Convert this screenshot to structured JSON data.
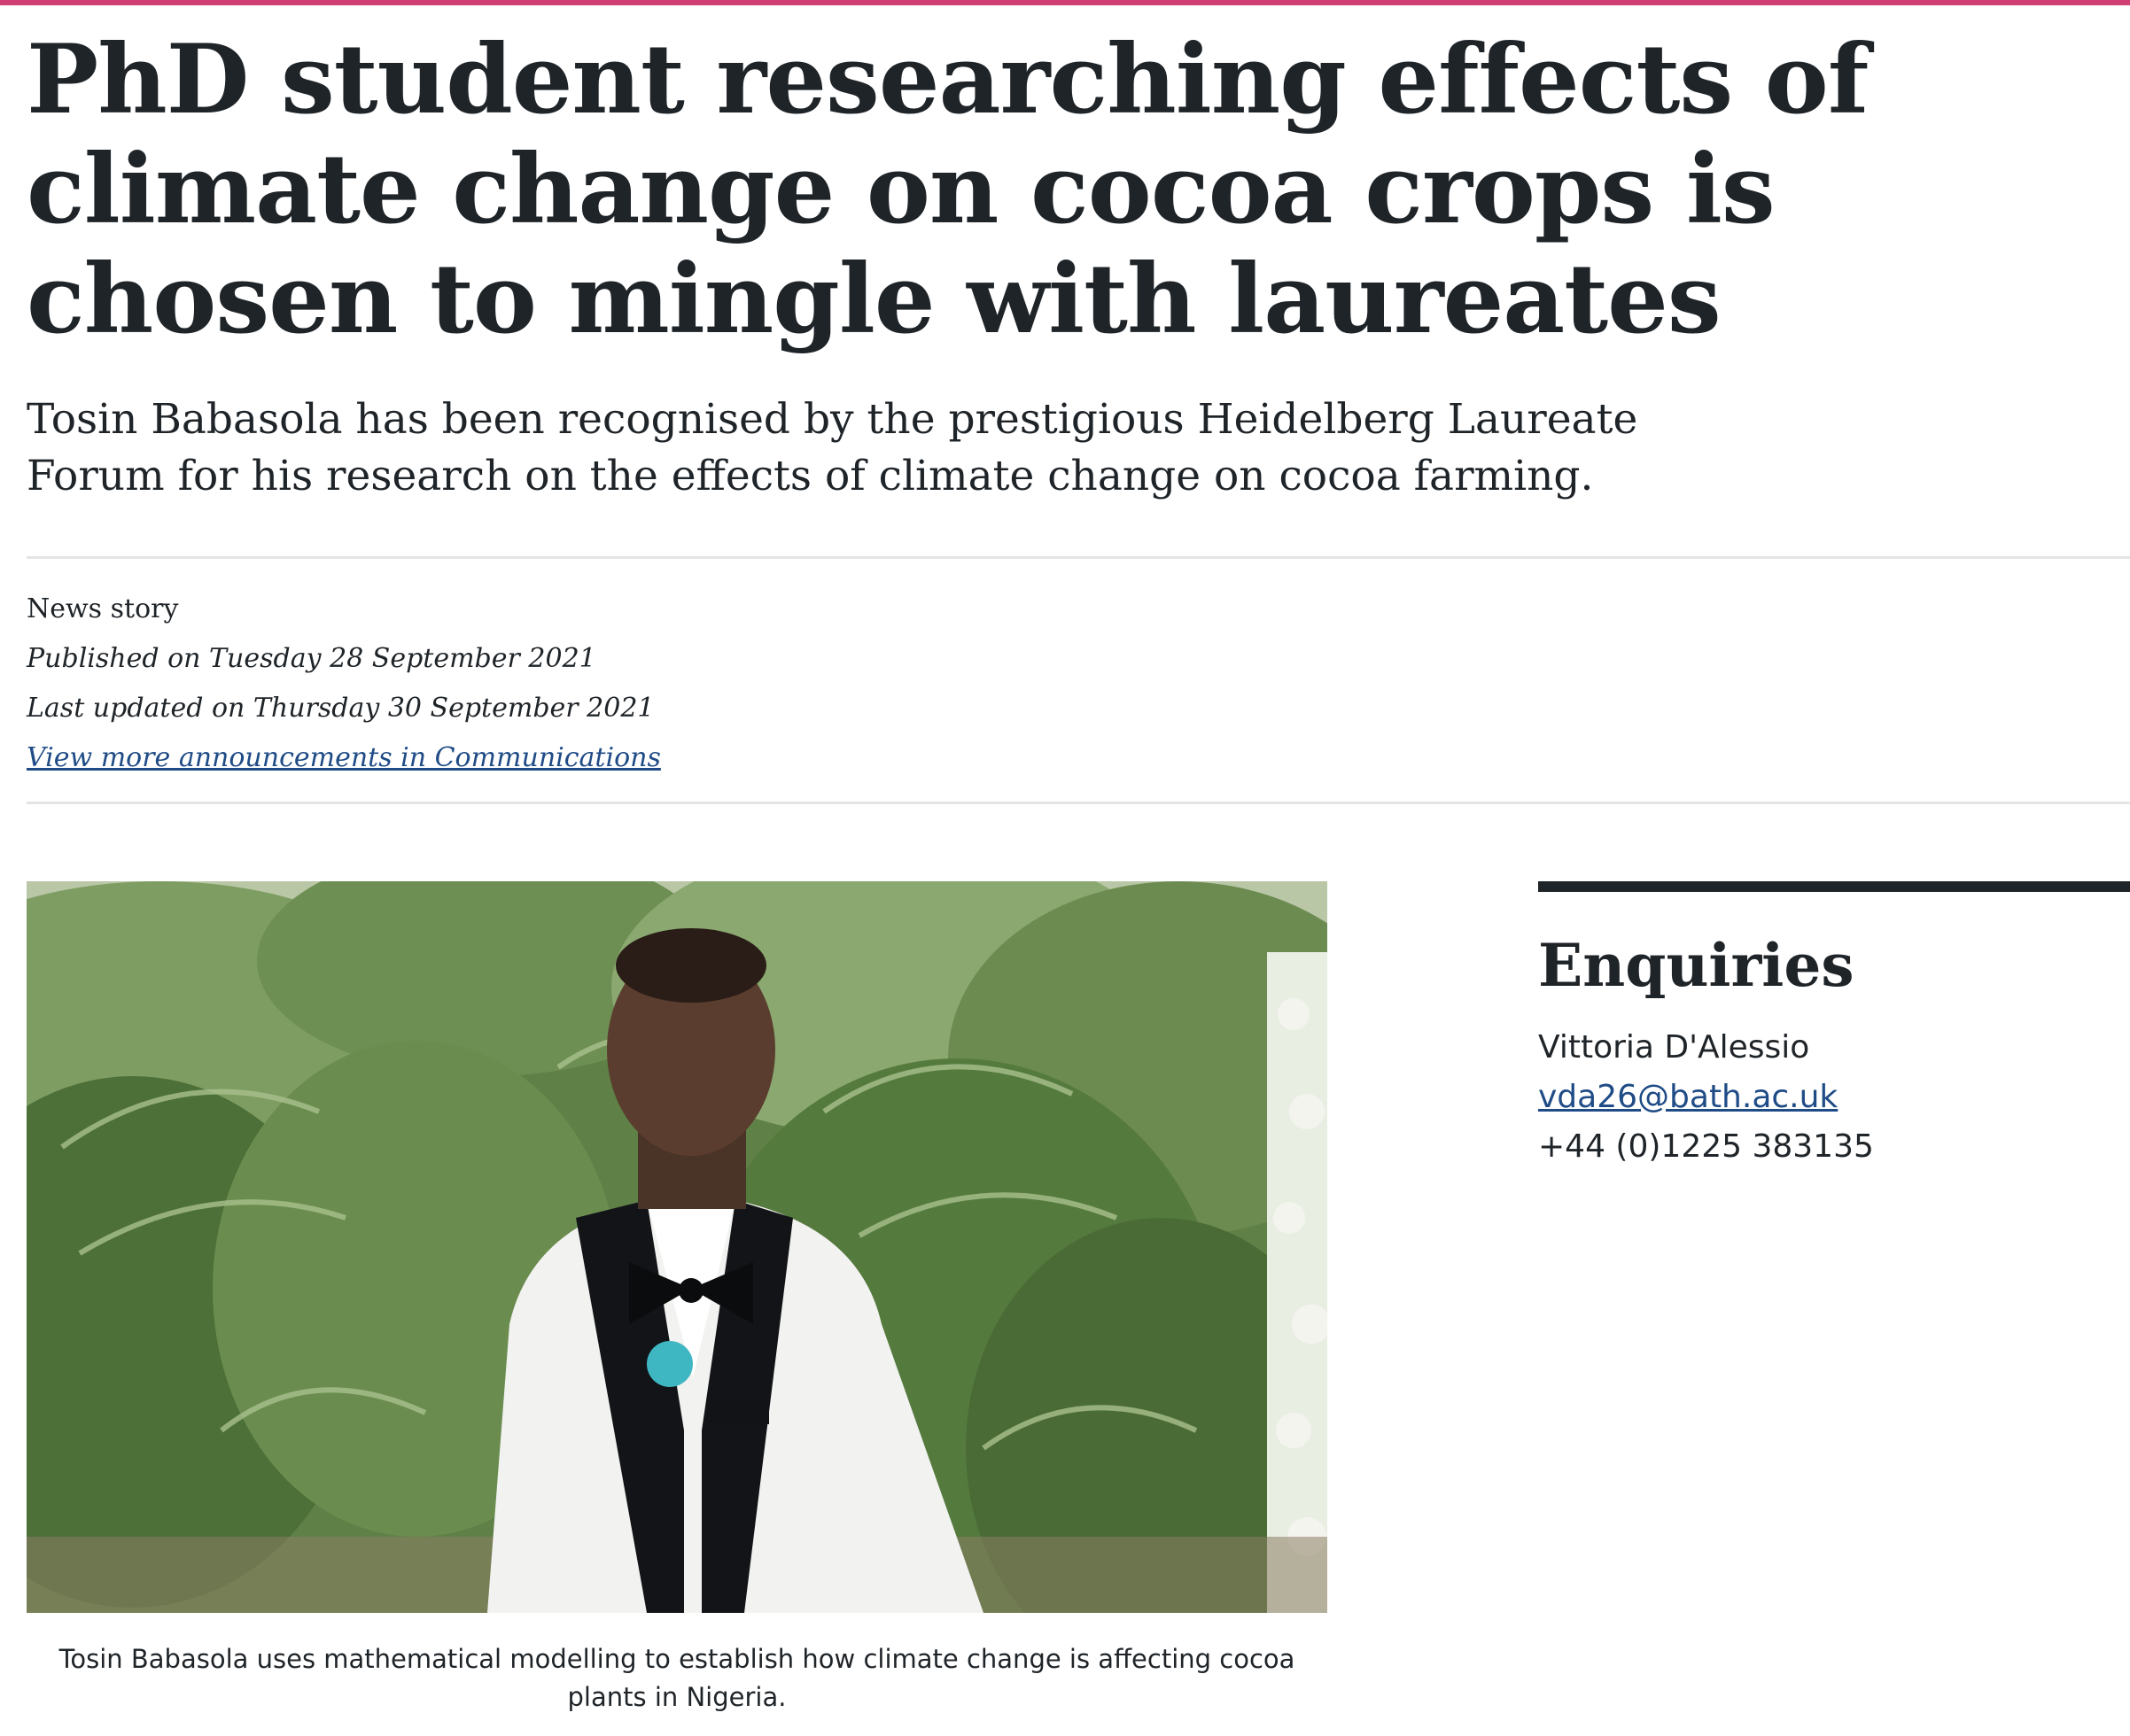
{
  "article": {
    "headline": "PhD student researching effects of climate change on cocoa crops is chosen to mingle with laureates",
    "standfirst": "Tosin Babasola has been recognised by the prestigious Heidelberg Laureate Forum for his research on the effects of climate change on cocoa farming.",
    "content_type": "News story",
    "published": "Published on Tuesday 28 September 2021",
    "updated": "Last updated on Thursday 30 September 2021",
    "more_link": "View more announcements in Communications",
    "image_alt": "Tosin Babasola standing in front of palm plants",
    "caption": "Tosin Babasola uses mathematical modelling to establish how climate change is affecting cocoa plants in Nigeria."
  },
  "enquiries": {
    "title": "Enquiries",
    "name": "Vittoria D'Alessio",
    "email": "vda26@bath.ac.uk",
    "phone": "+44 (0)1225 383135"
  },
  "colors": {
    "accent": "#cf3f74",
    "text": "#1f2429",
    "link": "#1f4b86",
    "divider": "#e4e4e4"
  }
}
